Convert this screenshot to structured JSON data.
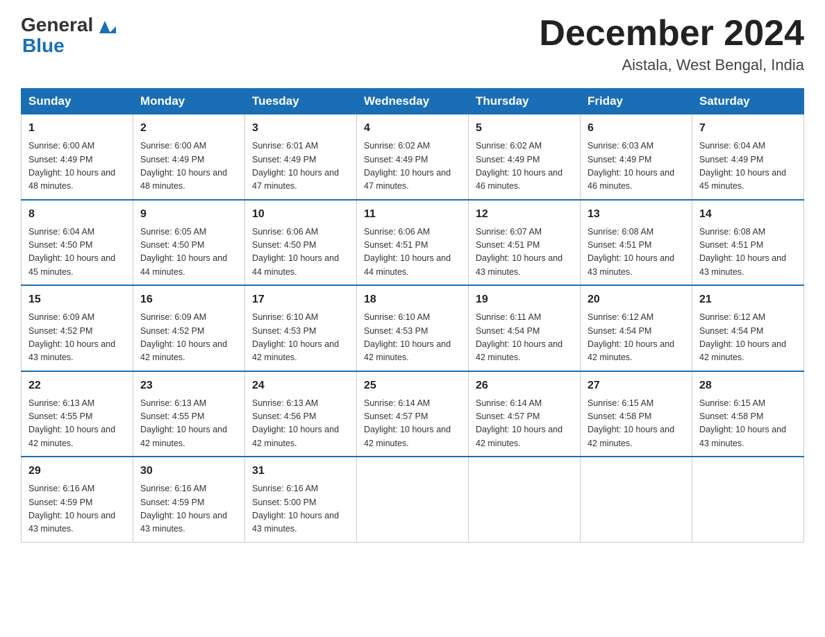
{
  "header": {
    "logo_general": "General",
    "logo_blue": "Blue",
    "month_title": "December 2024",
    "location": "Aistala, West Bengal, India"
  },
  "days_of_week": [
    "Sunday",
    "Monday",
    "Tuesday",
    "Wednesday",
    "Thursday",
    "Friday",
    "Saturday"
  ],
  "weeks": [
    [
      {
        "day": "1",
        "sunrise": "6:00 AM",
        "sunset": "4:49 PM",
        "daylight": "10 hours and 48 minutes."
      },
      {
        "day": "2",
        "sunrise": "6:00 AM",
        "sunset": "4:49 PM",
        "daylight": "10 hours and 48 minutes."
      },
      {
        "day": "3",
        "sunrise": "6:01 AM",
        "sunset": "4:49 PM",
        "daylight": "10 hours and 47 minutes."
      },
      {
        "day": "4",
        "sunrise": "6:02 AM",
        "sunset": "4:49 PM",
        "daylight": "10 hours and 47 minutes."
      },
      {
        "day": "5",
        "sunrise": "6:02 AM",
        "sunset": "4:49 PM",
        "daylight": "10 hours and 46 minutes."
      },
      {
        "day": "6",
        "sunrise": "6:03 AM",
        "sunset": "4:49 PM",
        "daylight": "10 hours and 46 minutes."
      },
      {
        "day": "7",
        "sunrise": "6:04 AM",
        "sunset": "4:49 PM",
        "daylight": "10 hours and 45 minutes."
      }
    ],
    [
      {
        "day": "8",
        "sunrise": "6:04 AM",
        "sunset": "4:50 PM",
        "daylight": "10 hours and 45 minutes."
      },
      {
        "day": "9",
        "sunrise": "6:05 AM",
        "sunset": "4:50 PM",
        "daylight": "10 hours and 44 minutes."
      },
      {
        "day": "10",
        "sunrise": "6:06 AM",
        "sunset": "4:50 PM",
        "daylight": "10 hours and 44 minutes."
      },
      {
        "day": "11",
        "sunrise": "6:06 AM",
        "sunset": "4:51 PM",
        "daylight": "10 hours and 44 minutes."
      },
      {
        "day": "12",
        "sunrise": "6:07 AM",
        "sunset": "4:51 PM",
        "daylight": "10 hours and 43 minutes."
      },
      {
        "day": "13",
        "sunrise": "6:08 AM",
        "sunset": "4:51 PM",
        "daylight": "10 hours and 43 minutes."
      },
      {
        "day": "14",
        "sunrise": "6:08 AM",
        "sunset": "4:51 PM",
        "daylight": "10 hours and 43 minutes."
      }
    ],
    [
      {
        "day": "15",
        "sunrise": "6:09 AM",
        "sunset": "4:52 PM",
        "daylight": "10 hours and 43 minutes."
      },
      {
        "day": "16",
        "sunrise": "6:09 AM",
        "sunset": "4:52 PM",
        "daylight": "10 hours and 42 minutes."
      },
      {
        "day": "17",
        "sunrise": "6:10 AM",
        "sunset": "4:53 PM",
        "daylight": "10 hours and 42 minutes."
      },
      {
        "day": "18",
        "sunrise": "6:10 AM",
        "sunset": "4:53 PM",
        "daylight": "10 hours and 42 minutes."
      },
      {
        "day": "19",
        "sunrise": "6:11 AM",
        "sunset": "4:54 PM",
        "daylight": "10 hours and 42 minutes."
      },
      {
        "day": "20",
        "sunrise": "6:12 AM",
        "sunset": "4:54 PM",
        "daylight": "10 hours and 42 minutes."
      },
      {
        "day": "21",
        "sunrise": "6:12 AM",
        "sunset": "4:54 PM",
        "daylight": "10 hours and 42 minutes."
      }
    ],
    [
      {
        "day": "22",
        "sunrise": "6:13 AM",
        "sunset": "4:55 PM",
        "daylight": "10 hours and 42 minutes."
      },
      {
        "day": "23",
        "sunrise": "6:13 AM",
        "sunset": "4:55 PM",
        "daylight": "10 hours and 42 minutes."
      },
      {
        "day": "24",
        "sunrise": "6:13 AM",
        "sunset": "4:56 PM",
        "daylight": "10 hours and 42 minutes."
      },
      {
        "day": "25",
        "sunrise": "6:14 AM",
        "sunset": "4:57 PM",
        "daylight": "10 hours and 42 minutes."
      },
      {
        "day": "26",
        "sunrise": "6:14 AM",
        "sunset": "4:57 PM",
        "daylight": "10 hours and 42 minutes."
      },
      {
        "day": "27",
        "sunrise": "6:15 AM",
        "sunset": "4:58 PM",
        "daylight": "10 hours and 42 minutes."
      },
      {
        "day": "28",
        "sunrise": "6:15 AM",
        "sunset": "4:58 PM",
        "daylight": "10 hours and 43 minutes."
      }
    ],
    [
      {
        "day": "29",
        "sunrise": "6:16 AM",
        "sunset": "4:59 PM",
        "daylight": "10 hours and 43 minutes."
      },
      {
        "day": "30",
        "sunrise": "6:16 AM",
        "sunset": "4:59 PM",
        "daylight": "10 hours and 43 minutes."
      },
      {
        "day": "31",
        "sunrise": "6:16 AM",
        "sunset": "5:00 PM",
        "daylight": "10 hours and 43 minutes."
      },
      null,
      null,
      null,
      null
    ]
  ],
  "labels": {
    "sunrise_prefix": "Sunrise: ",
    "sunset_prefix": "Sunset: ",
    "daylight_prefix": "Daylight: "
  }
}
